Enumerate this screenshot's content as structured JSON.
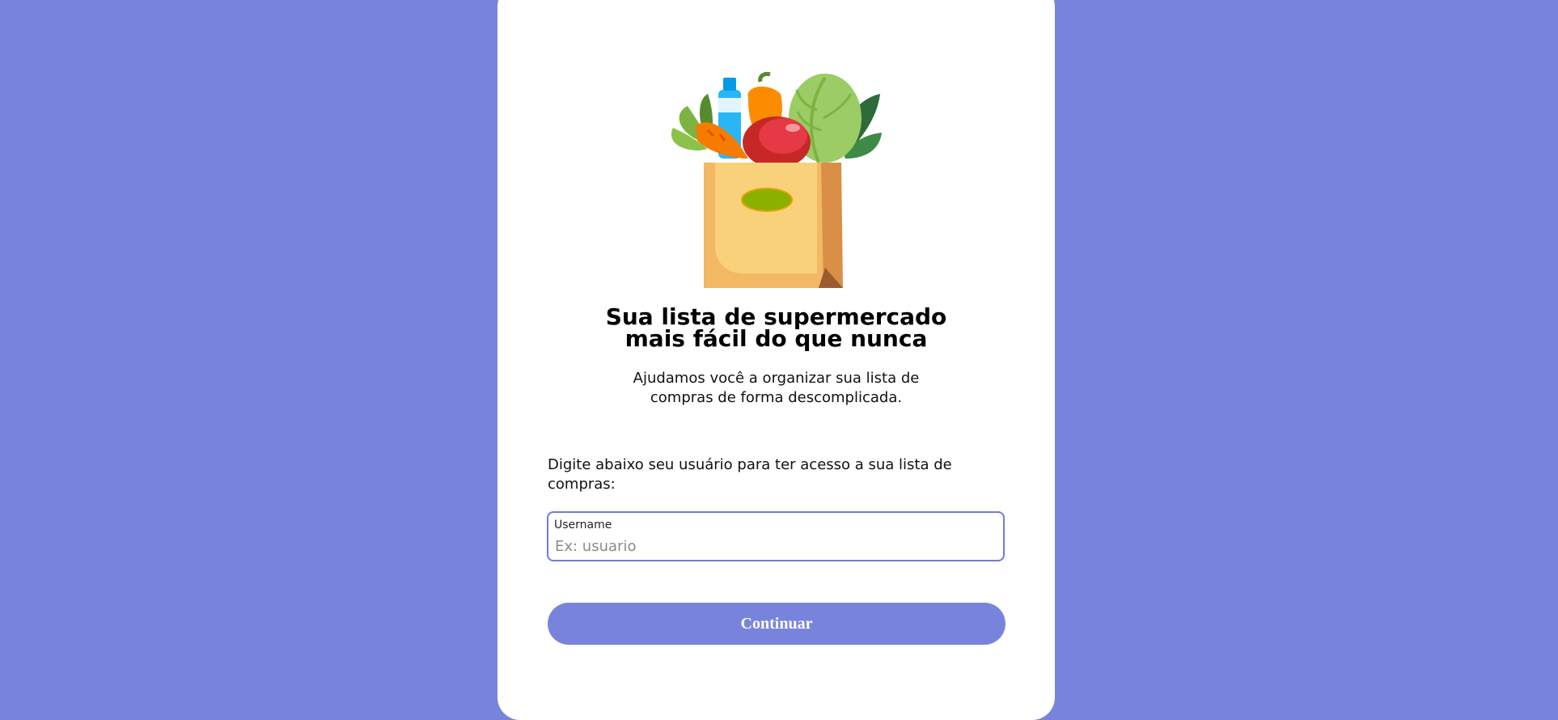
{
  "colors": {
    "background": "#7884dc",
    "card": "#ffffff",
    "accent": "#7884dc",
    "input_border": "#6f7cdb"
  },
  "illustration": {
    "icon": "grocery-bag-illustration"
  },
  "hero": {
    "title_line1": "Sua lista de supermercado",
    "title_line2": "mais fácil do que nunca",
    "subtitle_line1": "Ajudamos você a organizar sua lista de",
    "subtitle_line2": "compras de forma descomplicada."
  },
  "form": {
    "prompt": "Digite abaixo seu usuário para ter acesso a sua lista de compras:",
    "username_label": "Username",
    "username_placeholder": "Ex: usuario",
    "username_value": "",
    "continue_label": "Continuar"
  }
}
